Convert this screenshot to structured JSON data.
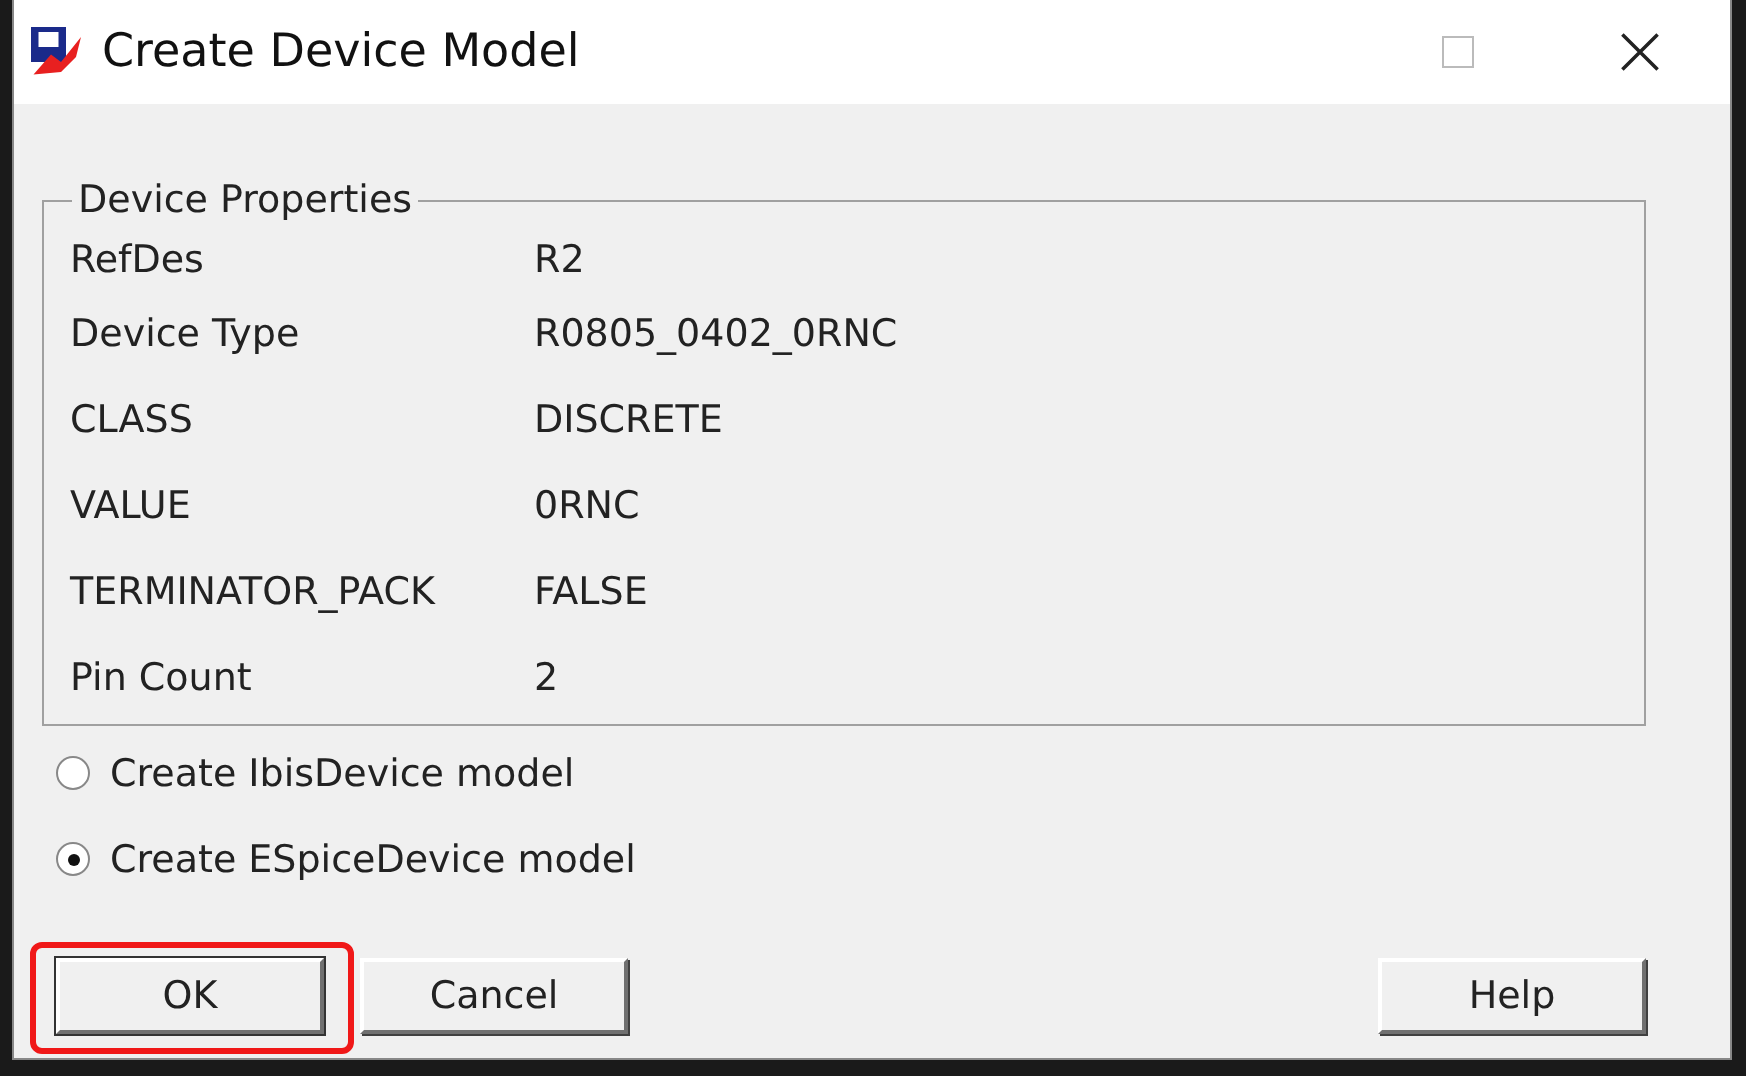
{
  "window": {
    "title": "Create Device Model",
    "controls": [
      {
        "kind": "maximize"
      },
      {
        "kind": "close"
      }
    ]
  },
  "group": {
    "title": "Device Properties",
    "rows": [
      {
        "name": "RefDes",
        "value": "R2"
      },
      {
        "name": "Device Type",
        "value": "R0805_0402_0RNC"
      },
      {
        "name": "CLASS",
        "value": "DISCRETE"
      },
      {
        "name": "VALUE",
        "value": "0RNC"
      },
      {
        "name": "TERMINATOR_PACK",
        "value": "FALSE"
      },
      {
        "name": "Pin Count",
        "value": "2"
      }
    ]
  },
  "options": [
    {
      "label": "Create IbisDevice model",
      "selected": false
    },
    {
      "label": "Create ESpiceDevice model",
      "selected": true
    }
  ],
  "buttons": [
    {
      "label": "OK",
      "annotated": true,
      "default": true
    },
    {
      "label": "Cancel",
      "annotated": false,
      "default": false
    },
    {
      "label": "Help",
      "annotated": false,
      "default": false
    }
  ]
}
